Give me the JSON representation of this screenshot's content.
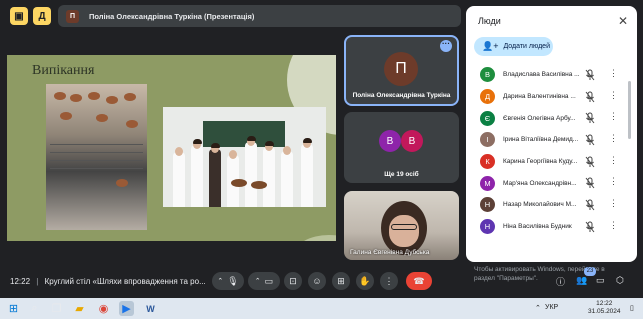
{
  "presentation": {
    "presenter_initial": "П",
    "title": "Поліна Олександрівна Туркіна (Презентація)"
  },
  "slide": {
    "heading": "Випікання"
  },
  "tiles": {
    "main": {
      "initial": "П",
      "name": "Поліна Олександрівна Туркіна"
    },
    "more": {
      "avatars": [
        {
          "initial": "В",
          "color": "#8e24aa"
        },
        {
          "initial": "В",
          "color": "#c2185b"
        }
      ],
      "label": "Ще 19 осіб"
    },
    "camera": {
      "name": "Галина Євгенівна Дубська"
    }
  },
  "panel": {
    "title": "Люди",
    "add_label": "Додати людей",
    "people": [
      {
        "initial": "В",
        "color": "#1e8e3e",
        "name": "Владислава Василівна ..."
      },
      {
        "initial": "Д",
        "color": "#e8710a",
        "name": "Дарина Валентинівна ..."
      },
      {
        "initial": "Є",
        "color": "#0b8043",
        "name": "Євгенія Олегівна Арбу..."
      },
      {
        "initial": "І",
        "color": "#8d6e63",
        "name": "Ірина Віталіївна Демид..."
      },
      {
        "initial": "К",
        "color": "#d93025",
        "name": "Карина Георгіївна Куду..."
      },
      {
        "initial": "М",
        "color": "#8e24aa",
        "name": "Мар'яна Олександрівн..."
      },
      {
        "initial": "Н",
        "color": "#5d4037",
        "name": "Назар Миколайович М..."
      },
      {
        "initial": "Н",
        "color": "#5e35b1",
        "name": "Ніна Василівна Будник"
      }
    ]
  },
  "bottom": {
    "time": "12:22",
    "meeting_title": "Круглий стіл «Шляхи впровадження та ро...",
    "participant_count": "23"
  },
  "watermark": "Чтобы активировать Windows, перейдите в раздел \"Параметры\".",
  "taskbar": {
    "language": "УКР",
    "time": "12:22",
    "date": "31.05.2024"
  }
}
